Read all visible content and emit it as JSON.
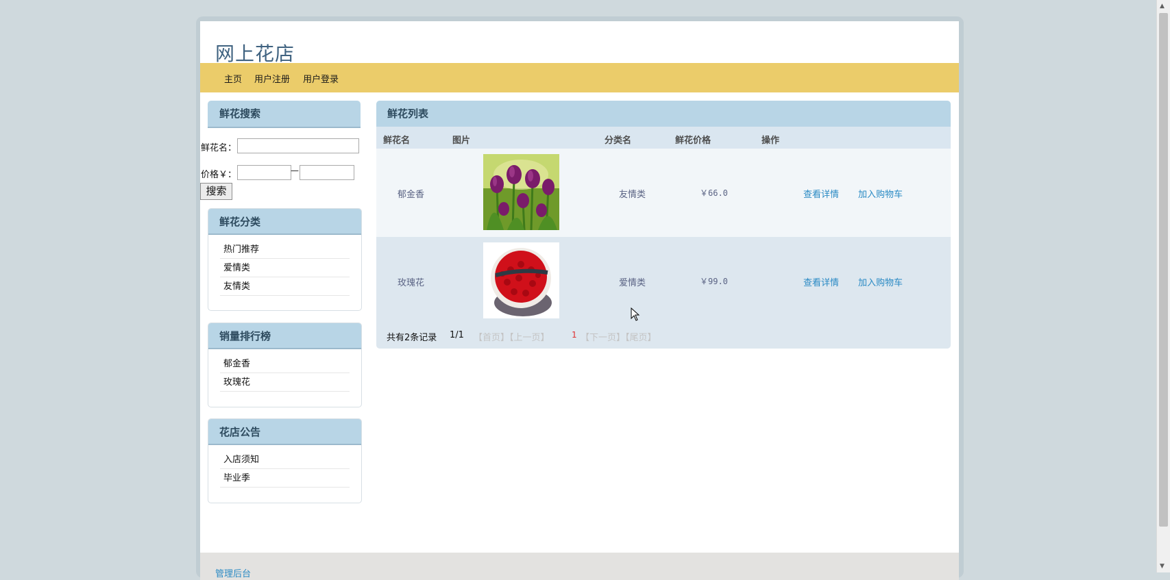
{
  "site": {
    "title": "网上花店"
  },
  "nav": {
    "items": [
      "主页",
      "用户注册",
      "用户登录"
    ]
  },
  "search": {
    "title": "鲜花搜索",
    "name_label": "鲜花名：",
    "price_label": "价格￥：",
    "price_sep": "—",
    "button": "搜索"
  },
  "category": {
    "title": "鲜花分类",
    "items": [
      "热门推荐",
      "爱情类",
      "友情类"
    ]
  },
  "ranking": {
    "title": "销量排行榜",
    "items": [
      "郁金香",
      "玫瑰花"
    ]
  },
  "notice": {
    "title": "花店公告",
    "items": [
      "入店须知",
      "毕业季"
    ]
  },
  "list": {
    "title": "鲜花列表",
    "columns": [
      "鲜花名",
      "图片",
      "分类名",
      "鲜花价格",
      "操作"
    ],
    "rows": [
      {
        "name": "郁金香",
        "category": "友情类",
        "price": "￥66.0",
        "detail": "查看详情",
        "cart": "加入购物车"
      },
      {
        "name": "玫瑰花",
        "category": "爱情类",
        "price": "￥99.0",
        "detail": "查看详情",
        "cart": "加入购物车"
      }
    ],
    "pager": {
      "total": "共有2条记录",
      "pages": "1/1",
      "first_prev": "【首页】【上一页】",
      "current": "1",
      "next_last": "【下一页】【尾页】"
    }
  },
  "footer": {
    "admin": "管理后台"
  },
  "colors": {
    "nav_bg": "#ebcc6a",
    "panel_head": "#b8d5e6",
    "link": "#2a8ac4",
    "current_page": "#e03030"
  }
}
